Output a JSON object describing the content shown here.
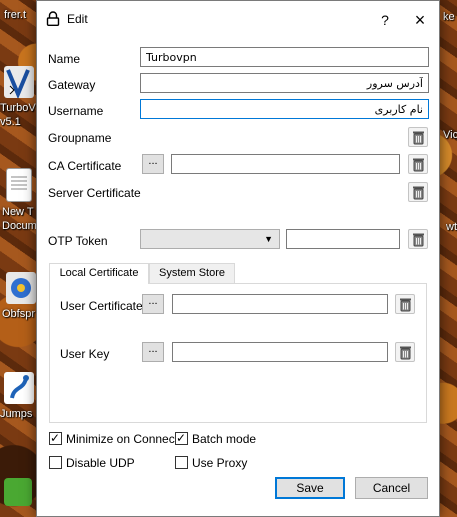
{
  "desktop": {
    "icons": [
      {
        "label": "frer.t"
      },
      {
        "label": "TurboV\nv5.1"
      },
      {
        "label": "New T\nDocum"
      },
      {
        "label": "Obfspr"
      },
      {
        "label": "Jumps"
      }
    ],
    "right_labels": [
      "ke",
      "Vic",
      "wt"
    ]
  },
  "dialog": {
    "title": "Edit",
    "help_glyph": "?",
    "close_glyph": "×",
    "fields": {
      "name": {
        "label": "Name",
        "value": "Turbovpn"
      },
      "gateway": {
        "label": "Gateway",
        "value": "آدرس سرور"
      },
      "username": {
        "label": "Username",
        "value": "نام کاربری"
      },
      "groupname": {
        "label": "Groupname"
      },
      "ca_certificate": {
        "label": "CA Certificate",
        "value": "",
        "browse": "..."
      },
      "server_certificate": {
        "label": "Server Certificate"
      },
      "otp_token": {
        "label": "OTP Token",
        "selected": "",
        "value": ""
      }
    },
    "tabs": [
      {
        "label": "Local Certificate",
        "active": true
      },
      {
        "label": "System Store",
        "active": false
      }
    ],
    "local_certificate": {
      "user_certificate": {
        "label": "User Certificate",
        "value": "",
        "browse": "..."
      },
      "user_key": {
        "label": "User Key",
        "value": "",
        "browse": "..."
      }
    },
    "options": {
      "minimize_on_connect": {
        "label": "Minimize on Connect",
        "checked": true
      },
      "batch_mode": {
        "label": "Batch mode",
        "checked": true
      },
      "disable_udp": {
        "label": "Disable UDP",
        "checked": false
      },
      "use_proxy": {
        "label": "Use Proxy",
        "checked": false
      }
    },
    "buttons": {
      "save": "Save",
      "cancel": "Cancel"
    }
  }
}
